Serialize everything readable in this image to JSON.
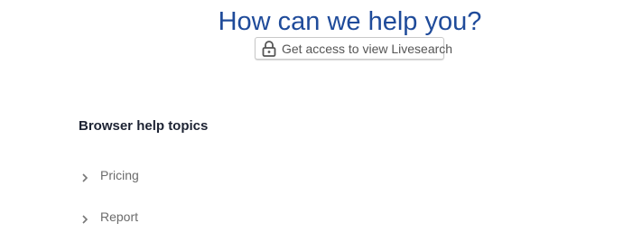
{
  "header": {
    "title": "How can we help you?"
  },
  "access": {
    "label": "Get access to view Livesearch",
    "icon": "lock-icon"
  },
  "topics": {
    "heading": "Browser help topics",
    "items": [
      {
        "label": "Pricing",
        "icon": "chevron-right-icon"
      },
      {
        "label": "Report",
        "icon": "chevron-right-icon"
      }
    ]
  },
  "colors": {
    "title": "#1f4b9a",
    "heading": "#1d2333",
    "topic_text": "#6b6b6b"
  }
}
